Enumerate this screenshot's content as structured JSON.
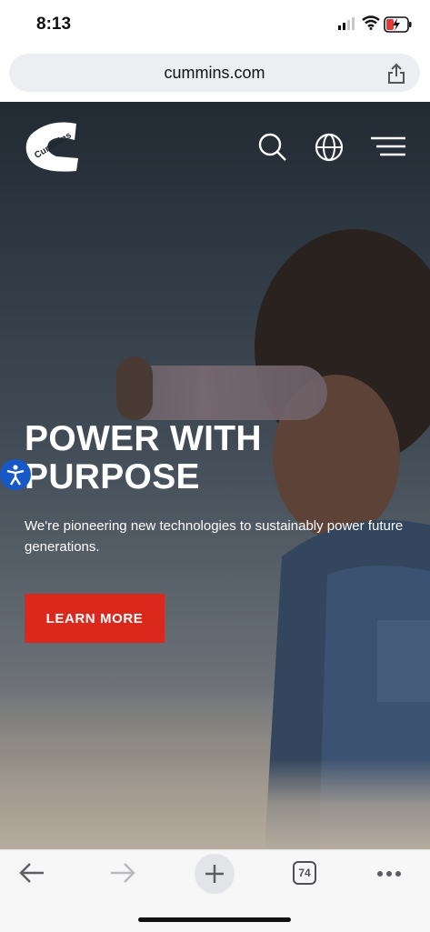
{
  "status": {
    "time": "8:13"
  },
  "browser": {
    "url": "cummins.com",
    "tab_count": "74"
  },
  "brand": {
    "logo_text": "Cummins",
    "accent": "#da291c"
  },
  "hero": {
    "title": "POWER WITH PURPOSE",
    "subtitle": "We're pioneering new technologies to sustainably power future generations.",
    "cta_label": "LEARN MORE"
  },
  "icons": {
    "nav": [
      "search-icon",
      "globe-icon",
      "hamburger-menu-icon"
    ],
    "browser": [
      "back-arrow-icon",
      "forward-arrow-icon",
      "new-tab-plus-icon",
      "tabs-counter-icon",
      "more-dots-icon",
      "share-icon"
    ]
  }
}
